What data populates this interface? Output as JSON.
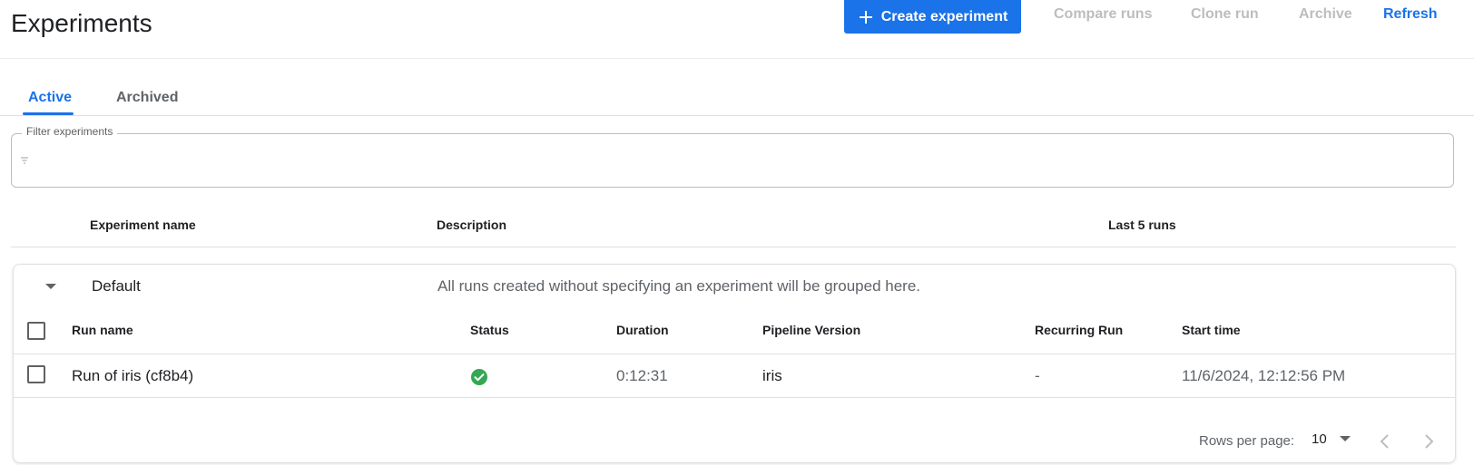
{
  "header": {
    "title": "Experiments",
    "create_label": "Create experiment",
    "compare_label": "Compare runs",
    "clone_label": "Clone run",
    "archive_label": "Archive",
    "refresh_label": "Refresh"
  },
  "tabs": [
    {
      "label": "Active",
      "selected": true
    },
    {
      "label": "Archived",
      "selected": false
    }
  ],
  "filter": {
    "label": "Filter experiments",
    "value": ""
  },
  "table": {
    "columns": [
      "Experiment name",
      "Description",
      "Last 5 runs"
    ]
  },
  "experiments": [
    {
      "name": "Default",
      "description": "All runs created without specifying an experiment will be grouped here.",
      "expanded": true,
      "run_columns": [
        "Run name",
        "Status",
        "Duration",
        "Pipeline Version",
        "Recurring Run",
        "Start time"
      ],
      "runs": [
        {
          "name": "Run of iris (cf8b4)",
          "status": "succeeded",
          "duration": "0:12:31",
          "pipeline_version": "iris",
          "recurring_run": "-",
          "start_time": "11/6/2024, 12:12:56 PM"
        }
      ],
      "pagination": {
        "rows_per_page_label": "Rows per page:",
        "rows_per_page": "10"
      }
    }
  ],
  "colors": {
    "primary": "#1a73e8",
    "disabled": "#bdbdbd",
    "success": "#34a853"
  },
  "icons": {
    "create": "plus-icon",
    "filter": "filter-icon",
    "expand": "caret-down-icon",
    "status": "check-circle-icon",
    "prev": "chevron-left-icon",
    "next": "chevron-right-icon"
  }
}
